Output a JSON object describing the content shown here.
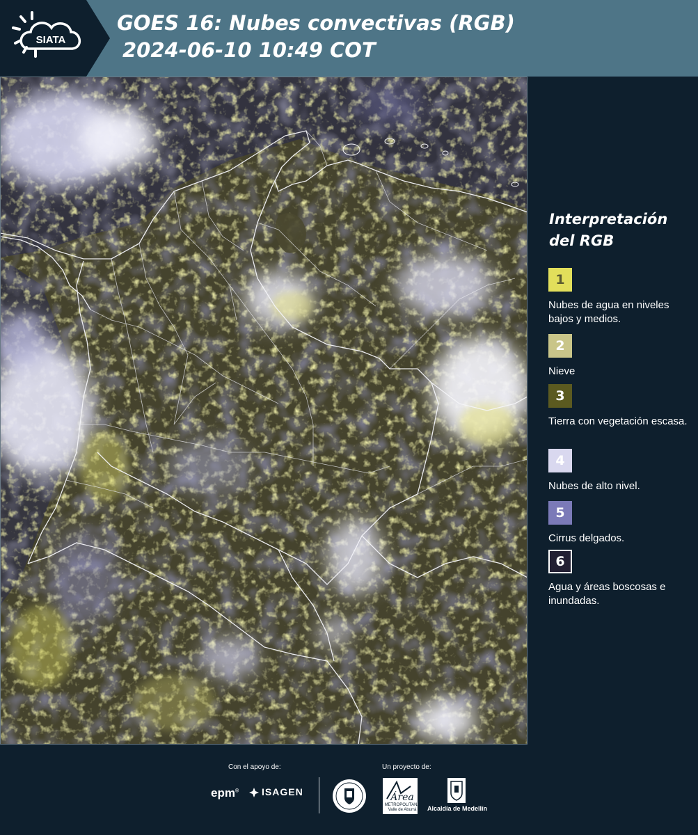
{
  "header": {
    "logo_text": "SIATA",
    "title_line1": "GOES 16: Nubes convectivas (RGB)",
    "title_line2": "2024-06-10 10:49 COT"
  },
  "legend": {
    "title": "Interpretación del RGB",
    "items": [
      {
        "number": "1",
        "label": "Nubes de agua en niveles bajos y medios.",
        "color": "#e2df5b",
        "text_color": "#5a5a30"
      },
      {
        "number": "2",
        "label": "Nieve",
        "color": "#c9c589",
        "text_color": "#ffffff"
      },
      {
        "number": "3",
        "label": "Tierra con vegetación escasa.",
        "color": "#5b5a20",
        "text_color": "#ffffff"
      },
      {
        "number": "4",
        "label": "Nubes de alto nivel.",
        "color": "#d9d8ef",
        "text_color": "#ffffff"
      },
      {
        "number": "5",
        "label": "Cirrus delgados.",
        "color": "#7b7ab8",
        "text_color": "#ffffff"
      },
      {
        "number": "6",
        "label": "Agua y áreas boscosas e inundadas.",
        "color": "#221f33",
        "text_color": "#ffffff"
      }
    ]
  },
  "footer": {
    "support_label": "Con el apoyo de:",
    "project_label": "Un proyecto de:",
    "sponsors": [
      "epm",
      "ISAGEN"
    ],
    "partners": [
      "Área Metropolitana Valle de Aburrá",
      "Alcaldía de Medellín"
    ],
    "area_text": "METROPOLITANA Valle de Aburrá",
    "area_script": "Área",
    "alcaldia_text": "Alcaldía de Medellín"
  },
  "colors": {
    "header_bg": "#4e7587",
    "panel_bg": "#0e1f2d",
    "land": "#4d4a2c",
    "low_cloud": "#e0de6a",
    "high_cloud": "#e9e8f7",
    "water": "#30303f"
  }
}
